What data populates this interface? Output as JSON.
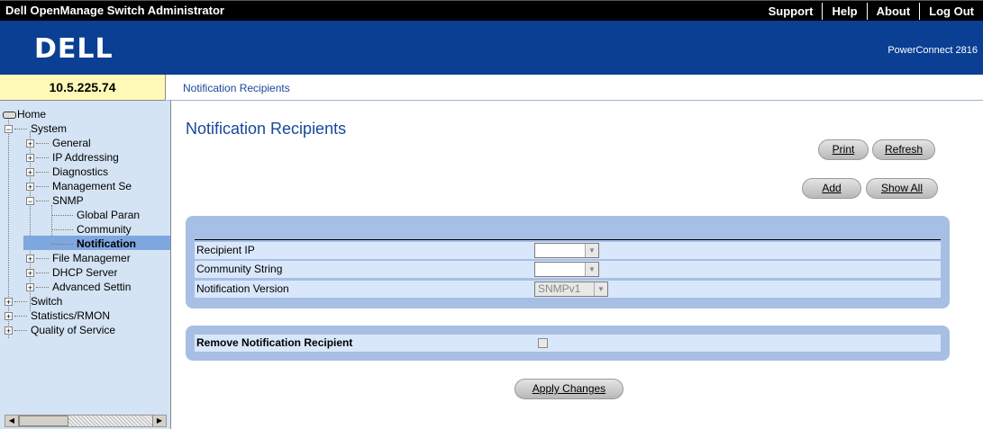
{
  "topbar": {
    "title": "Dell OpenManage Switch Administrator",
    "links": [
      "Support",
      "Help",
      "About",
      "Log Out"
    ]
  },
  "banner": {
    "logo": "DELL",
    "product": "PowerConnect 2816"
  },
  "device_ip": "10.5.225.74",
  "breadcrumb": "Notification Recipients",
  "tree": {
    "home": "Home",
    "system": "System",
    "general": "General",
    "ip_addressing": "IP Addressing",
    "diagnostics": "Diagnostics",
    "management_se": "Management Se",
    "snmp": "SNMP",
    "global_param": "Global Paran",
    "community": "Community",
    "notification": "Notification",
    "file_management": "File Managemer",
    "dhcp_server": "DHCP Server",
    "advanced_settings": "Advanced Settin",
    "switch": "Switch",
    "statistics": "Statistics/RMON",
    "qos": "Quality of Service"
  },
  "main": {
    "title": "Notification Recipients",
    "print": "Print",
    "refresh": "Refresh",
    "add": "Add",
    "show_all": "Show All",
    "fields": {
      "recipient_ip": "Recipient IP",
      "community_string": "Community String",
      "notification_version": "Notification Version",
      "notification_version_value": "SNMPv1"
    },
    "remove_label": "Remove Notification Recipient",
    "apply": "Apply Changes"
  },
  "colors": {
    "banner_blue": "#0a3f93",
    "sidebar_bg": "#d4e4f4",
    "ip_bg": "#fff9b8",
    "panel_bg": "#a7bfe4",
    "row_bg": "#d9e7fa",
    "selected_node": "#7fa7df",
    "link_blue": "#17489b"
  }
}
